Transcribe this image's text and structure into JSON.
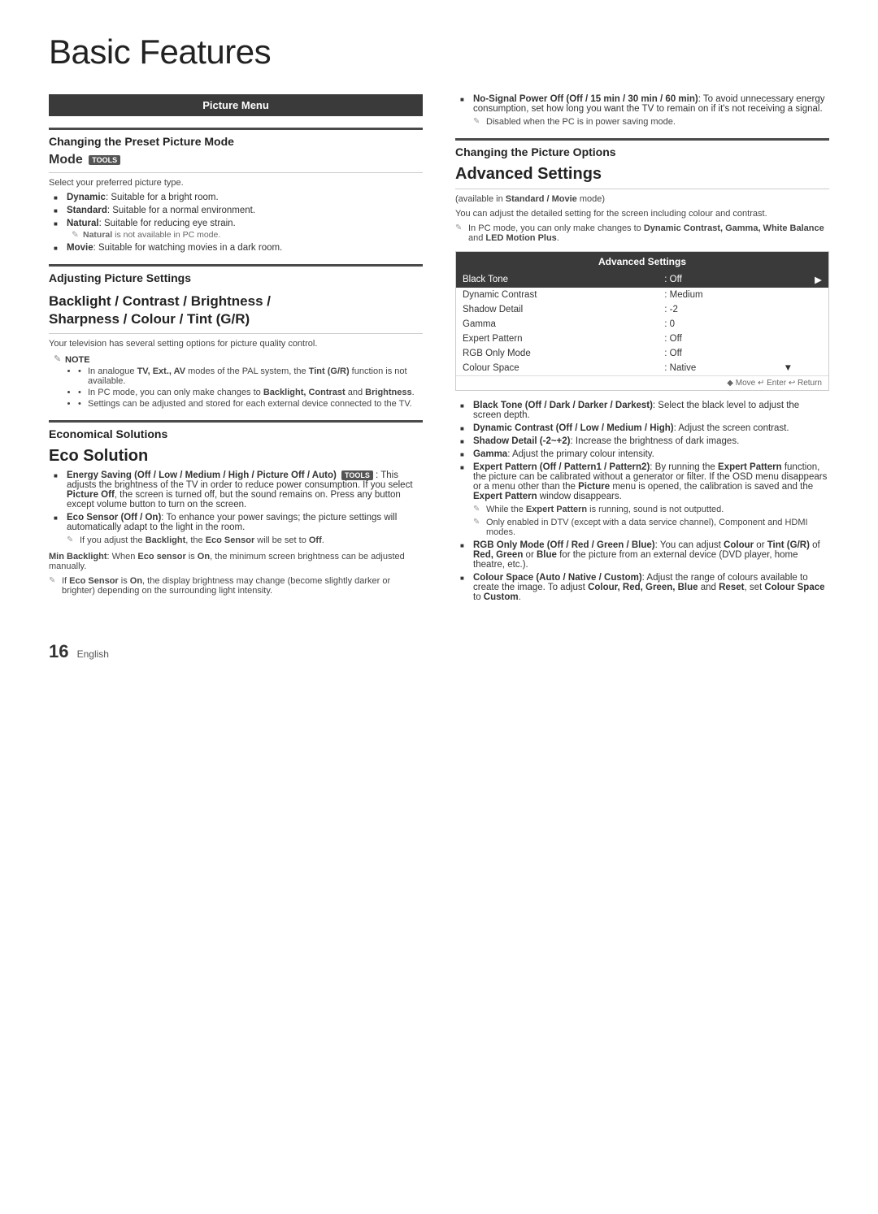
{
  "page": {
    "title": "Basic Features",
    "number": "16",
    "number_label": "English"
  },
  "left_col": {
    "picture_menu_header": "Picture Menu",
    "section1": {
      "label": "Changing the Preset Picture Mode"
    },
    "mode": {
      "heading": "Mode",
      "tools_badge": "TOOLS",
      "description": "Select your preferred picture type.",
      "items": [
        {
          "bold": "Dynamic",
          "text": ": Suitable for a bright room."
        },
        {
          "bold": "Standard",
          "text": ": Suitable for a normal environment."
        },
        {
          "bold": "Natural",
          "text": ": Suitable for reducing eye strain."
        },
        {
          "bold": "Movie",
          "text": ": Suitable for watching movies in a dark room."
        }
      ],
      "natural_note": "Natural is not available in PC mode."
    },
    "section2": {
      "label": "Adjusting Picture Settings"
    },
    "backlight_title": "Backlight / Contrast / Brightness / Sharpness / Colour / Tint (G/R)",
    "backlight_desc": "Your television has several setting options for picture quality control.",
    "note_label": "NOTE",
    "note_items": [
      "In analogue TV, Ext., AV modes of the PAL system, the Tint (G/R) function is not available.",
      "In PC mode, you can only make changes to Backlight, Contrast and Brightness.",
      "Settings can be adjusted and stored for each external device connected to the TV."
    ],
    "note_item1_bold1": "Tint (G/R)",
    "note_item2_bold1": "Backlight, Contrast",
    "note_item2_bold2": "Brightness",
    "section3": {
      "label": "Economical Solutions"
    },
    "eco_title": "Eco Solution",
    "eco_items": [
      {
        "bold": "Energy Saving (Off / Low / Medium / High / Picture Off / Auto)",
        "tools": true,
        "text": ": This adjusts the brightness of the TV in order to reduce power consumption. If you select Picture Off, the screen is turned off, but the sound remains on. Press any button except volume button to turn on the screen."
      },
      {
        "bold": "Eco Sensor (Off / On)",
        "text": ": To enhance your power savings; the picture settings will automatically adapt to the light in the room.",
        "sub_note": "If you adjust the Backlight, the Eco Sensor will be set to Off."
      }
    ],
    "min_backlight_label": "Min Backlight",
    "min_backlight_text": ": When Eco sensor is On, the minimum screen brightness can be adjusted manually.",
    "eco_sensor_note1": "If Eco Sensor is On, the display brightness may change (become slightly darker or brighter) depending on the surrounding light intensity.",
    "no_signal_note": "No-Signal Power Off (Off / 15 min / 30 min / 60 min):",
    "no_signal_text": "To avoid unnecessary energy consumption, set how long you want the TV to remain on if it's not receiving a signal.",
    "no_signal_sub": "Disabled when the PC is in power saving mode."
  },
  "right_col": {
    "section1": {
      "label": "Changing the Picture Options"
    },
    "advanced_title": "Advanced Settings",
    "advanced_available": "(available in Standard / Movie mode)",
    "advanced_desc": "You can adjust the detailed setting for the screen including colour and contrast.",
    "advanced_pc_note": "In PC mode, you can only make changes to Dynamic Contrast, Gamma, White Balance and LED Motion Plus.",
    "advanced_table": {
      "header": "Advanced Settings",
      "rows": [
        {
          "label": "Black Tone",
          "value": ": Off",
          "highlight": true
        },
        {
          "label": "Dynamic Contrast",
          "value": ": Medium"
        },
        {
          "label": "Shadow Detail",
          "value": ": -2"
        },
        {
          "label": "Gamma",
          "value": ": 0"
        },
        {
          "label": "Expert Pattern",
          "value": ": Off"
        },
        {
          "label": "RGB Only Mode",
          "value": ": Off"
        },
        {
          "label": "Colour Space",
          "value": ": Native"
        }
      ],
      "footer": "◆ Move  ↵ Enter  ↩ Return"
    },
    "bullet_items": [
      {
        "bold": "Black Tone (Off / Dark / Darker / Darkest)",
        "text": ": Select the black level to adjust the screen depth."
      },
      {
        "bold": "Dynamic Contrast (Off / Low / Medium / High)",
        "text": ": Adjust the screen contrast."
      },
      {
        "bold": "Shadow Detail (-2~+2)",
        "text": ": Increase the brightness of dark images."
      },
      {
        "bold": "Gamma",
        "text": ": Adjust the primary colour intensity."
      },
      {
        "bold": "Expert Pattern (Off / Pattern1 / Pattern2)",
        "text": ": By running the Expert Pattern function, the picture can be calibrated without a generator or filter. If the OSD menu disappears or a menu other than the Picture menu is opened, the calibration is saved and the Expert Pattern window disappears.",
        "notes": [
          "While the Expert Pattern is running, sound is not outputted.",
          "Only enabled in DTV (except with a data service channel), Component and HDMI modes."
        ]
      },
      {
        "bold": "RGB Only Mode (Off / Red / Green / Blue)",
        "text": ": You can adjust Colour or Tint (G/R) of Red, Green or Blue for the picture from an external device (DVD player, home theatre, etc.)."
      },
      {
        "bold": "Colour Space (Auto / Native / Custom)",
        "text": ": Adjust the range of colours available to create the image. To adjust Colour, Red, Green, Blue and Reset, set Colour Space to Custom."
      }
    ]
  }
}
